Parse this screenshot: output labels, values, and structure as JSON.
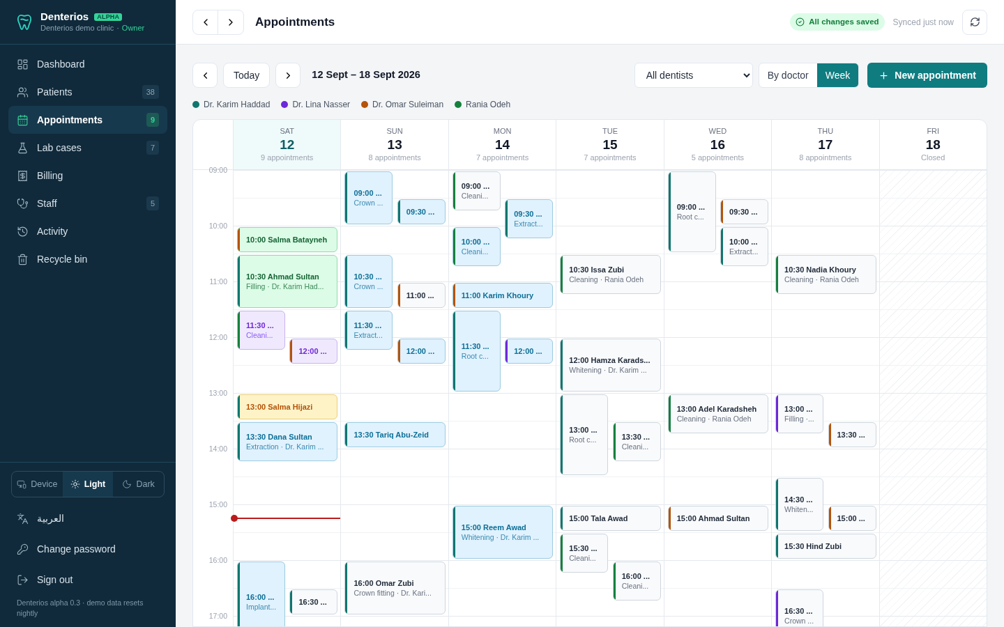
{
  "sidebar": {
    "brand": "Denterios",
    "badge": "ALPHA",
    "clinic": "Denterios demo clinic",
    "separator": "·",
    "role": "Owner",
    "nav": [
      {
        "label": "Dashboard",
        "selected": false
      },
      {
        "label": "Patients",
        "count": "38",
        "selected": false
      },
      {
        "label": "Appointments",
        "count": "9",
        "selected": true
      },
      {
        "label": "Lab cases",
        "count": "7",
        "selected": false
      },
      {
        "label": "Billing",
        "selected": false
      },
      {
        "label": "Staff",
        "count": "5",
        "selected": false
      },
      {
        "label": "Activity",
        "selected": false
      },
      {
        "label": "Recycle bin",
        "selected": false
      }
    ],
    "theme_options": [
      {
        "label": "Device",
        "selected": false
      },
      {
        "label": "Light",
        "selected": true
      },
      {
        "label": "Dark",
        "selected": false
      }
    ],
    "links": [
      "العربية",
      "Change password",
      "Sign out"
    ],
    "footer": "Denterios alpha 0.3 · demo data resets nightly"
  },
  "header": {
    "title": "Appointments",
    "save_status": "All changes saved",
    "sync_text": "Synced just now"
  },
  "toolbar": {
    "today": "Today",
    "range": "12 Sept – 18 Sept 2026",
    "dentist_select": "All dentists",
    "views": [
      {
        "label": "By doctor",
        "selected": false
      },
      {
        "label": "Week",
        "selected": true
      }
    ],
    "new_button": "New appointment"
  },
  "legend": [
    {
      "name": "Dr. Karim Haddad",
      "color": "#0f766e"
    },
    {
      "name": "Dr. Lina Nasser",
      "color": "#6d28d9"
    },
    {
      "name": "Dr. Omar Suleiman",
      "color": "#b45309"
    },
    {
      "name": "Rania Odeh",
      "color": "#15803d"
    }
  ],
  "calendar": {
    "times": [
      "09:00",
      "10:00",
      "11:00",
      "12:00",
      "13:00",
      "14:00",
      "15:00",
      "16:00",
      "17:00"
    ],
    "days": [
      {
        "weekday": "SAT",
        "date": "12",
        "summary": "9 appointments",
        "today": true,
        "closed": false,
        "events": [
          {
            "kind": "full30",
            "stripe": {
              "color": "#b45309"
            },
            "color": "#dcfce7",
            "time": "10:00",
            "name": "Salma Batayneh"
          },
          {
            "kind": "full60",
            "stripe": {
              "color": "#0f766e"
            },
            "color": "#dcfce7",
            "time": "10:30",
            "name": "Ahmad Sultan",
            "detail": "Filling · Dr. Karim Had..."
          },
          {
            "kind": "left45",
            "stripe": {
              "color": "#15803d"
            },
            "color": "#f0e9fd",
            "time": "11:30",
            "name": "...",
            "detail": "Cleani..."
          },
          {
            "kind": "right30",
            "stripe": {
              "color": "#b45309"
            },
            "color": "#f0e9fd",
            "time": "12:00",
            "name": "..."
          },
          {
            "kind": "full30",
            "stripe": {
              "color": "#0f766e"
            },
            "color": "#fef3c7",
            "time": "13:00",
            "name": "Salma Hijazi"
          },
          {
            "kind": "full45",
            "stripe": {
              "color": "#0f766e"
            },
            "color": "#e0f2fe",
            "time": "13:30",
            "name": "Dana Sultan",
            "detail": "Extraction · Dr. Karim ..."
          },
          {
            "kind": "left90",
            "stripe": {
              "color": "#0f766e"
            },
            "color": "#e0f2fe",
            "time": "16:00",
            "name": "...",
            "detail": "Implant..."
          },
          {
            "kind": "right30",
            "stripe": {
              "color": "#0f766e"
            },
            "color": "#f8fafc",
            "time": "16:30",
            "name": "..."
          }
        ]
      },
      {
        "weekday": "SUN",
        "date": "13",
        "summary": "8 appointments",
        "today": false,
        "closed": false,
        "events": [
          {
            "kind": "left60",
            "stripe": {
              "color": "#0f766e"
            },
            "color": "#e0f2fe",
            "time": "09:00",
            "name": "...",
            "detail": "Crown ..."
          },
          {
            "kind": "right30",
            "stripe": {
              "color": "#0f766e"
            },
            "color": "#e0f2fe",
            "time": "09:30",
            "name": "..."
          },
          {
            "kind": "left60",
            "stripe": {
              "color": "#0f766e"
            },
            "color": "#e0f2fe",
            "time": "10:30",
            "name": "...",
            "detail": "Crown ..."
          },
          {
            "kind": "right30",
            "stripe": {
              "color": "#b45309"
            },
            "color": "#f8fafc",
            "time": "11:00",
            "name": "..."
          },
          {
            "kind": "left45",
            "stripe": {
              "color": "#0f766e"
            },
            "color": "#e0f2fe",
            "time": "11:30",
            "name": "...",
            "detail": "Extract..."
          },
          {
            "kind": "right30",
            "stripe": {
              "color": "#b45309"
            },
            "color": "#e0f2fe",
            "time": "12:00",
            "name": "..."
          },
          {
            "kind": "full30",
            "stripe": {
              "color": "#0f766e"
            },
            "color": "#e0f2fe",
            "time": "13:30",
            "name": "Tariq Abu-Zeid"
          },
          {
            "kind": "full60",
            "stripe": {
              "color": "#0f766e"
            },
            "color": "#f8fafc",
            "time": "16:00",
            "name": "Omar Zubi",
            "detail": "Crown fitting · Dr. Kari..."
          }
        ]
      },
      {
        "weekday": "MON",
        "date": "14",
        "summary": "7 appointments",
        "today": false,
        "closed": false,
        "events": [
          {
            "kind": "left45",
            "stripe": {
              "color": "#15803d"
            },
            "color": "#f8fafc",
            "time": "09:00",
            "name": "...",
            "detail": "Cleani..."
          },
          {
            "kind": "right45",
            "stripe": {
              "color": "#0f766e"
            },
            "color": "#e0f2fe",
            "time": "09:30",
            "name": "...",
            "detail": "Extract..."
          },
          {
            "kind": "left45",
            "stripe": {
              "color": "#15803d"
            },
            "color": "#e0f2fe",
            "time": "10:00",
            "name": "...",
            "detail": "Cleani..."
          },
          {
            "kind": "full30",
            "stripe": {
              "color": "#b45309"
            },
            "color": "#e0f2fe",
            "time": "11:00",
            "name": "Karim Khoury"
          },
          {
            "kind": "left90",
            "stripe": {
              "color": "#0f766e"
            },
            "color": "#e0f2fe",
            "time": "11:30",
            "name": "...",
            "detail": "Root c..."
          },
          {
            "kind": "right30",
            "stripe": {
              "color": "#6d28d9"
            },
            "color": "#e0f2fe",
            "time": "12:00",
            "name": "..."
          },
          {
            "kind": "full60",
            "stripe": {
              "color": "#0f766e"
            },
            "color": "#e0f2fe",
            "time": "15:00",
            "name": "Reem Awad",
            "detail": "Whitening · Dr. Karim ..."
          }
        ]
      },
      {
        "weekday": "TUE",
        "date": "15",
        "summary": "7 appointments",
        "today": false,
        "closed": false,
        "events": [
          {
            "kind": "full45",
            "stripe": {
              "color": "#15803d"
            },
            "color": "#f8fafc",
            "time": "10:30",
            "name": "Issa Zubi",
            "detail": "Cleaning · Rania Odeh"
          },
          {
            "kind": "full60",
            "stripe": {
              "color": "#0f766e"
            },
            "color": "#f8fafc",
            "time": "12:00",
            "name": "Hamza Karads...",
            "detail": "Whitening · Dr. Karim ..."
          },
          {
            "kind": "left90",
            "stripe": {
              "color": "#0f766e"
            },
            "color": "#f8fafc",
            "time": "13:00",
            "name": "...",
            "detail": "Root c..."
          },
          {
            "kind": "right45",
            "stripe": {
              "color": "#15803d"
            },
            "color": "#f8fafc",
            "time": "13:30",
            "name": "...",
            "detail": "Cleani..."
          },
          {
            "kind": "full30",
            "stripe": {
              "color": "#0f766e"
            },
            "color": "#f8fafc",
            "time": "15:00",
            "name": "Tala Awad"
          },
          {
            "kind": "left45",
            "stripe": {
              "color": "#15803d"
            },
            "color": "#f8fafc",
            "time": "15:30",
            "name": "...",
            "detail": "Cleani..."
          },
          {
            "kind": "right45",
            "stripe": {
              "color": "#15803d"
            },
            "color": "#f8fafc",
            "time": "16:00",
            "name": "...",
            "detail": "Cleani..."
          }
        ]
      },
      {
        "weekday": "WED",
        "date": "16",
        "summary": "5 appointments",
        "today": false,
        "closed": false,
        "events": [
          {
            "kind": "left90",
            "stripe": {
              "color": "#0f766e"
            },
            "color": "#f8fafc",
            "time": "09:00",
            "name": "...",
            "detail": "Root c..."
          },
          {
            "kind": "right30",
            "stripe": {
              "color": "#b45309"
            },
            "color": "#f8fafc",
            "time": "09:30",
            "name": "..."
          },
          {
            "kind": "right45",
            "stripe": {
              "color": "#0f766e"
            },
            "color": "#f8fafc",
            "time": "10:00",
            "name": "...",
            "detail": "Extract..."
          },
          {
            "kind": "full45",
            "stripe": {
              "color": "#15803d"
            },
            "color": "#f8fafc",
            "time": "13:00",
            "name": "Adel Karadsheh",
            "detail": "Cleaning · Rania Odeh"
          },
          {
            "kind": "full30",
            "stripe": {
              "color": "#b45309"
            },
            "color": "#f8fafc",
            "time": "15:00",
            "name": "Ahmad Sultan"
          }
        ]
      },
      {
        "weekday": "THU",
        "date": "17",
        "summary": "8 appointments",
        "today": false,
        "closed": false,
        "events": [
          {
            "kind": "full45",
            "stripe": {
              "color": "#15803d"
            },
            "color": "#f8fafc",
            "time": "10:30",
            "name": "Nadia Khoury",
            "detail": "Cleaning · Rania Odeh"
          },
          {
            "kind": "left45",
            "stripe": {
              "color": "#6d28d9"
            },
            "color": "#f8fafc",
            "time": "13:00",
            "name": "...",
            "detail": "Filling ·..."
          },
          {
            "kind": "right30",
            "stripe": {
              "color": "#b45309"
            },
            "color": "#f8fafc",
            "time": "13:30",
            "name": "..."
          },
          {
            "kind": "left60",
            "stripe": {
              "color": "#0f766e"
            },
            "color": "#f8fafc",
            "time": "14:30",
            "name": "...",
            "detail": "Whiten..."
          },
          {
            "kind": "right30",
            "stripe": {
              "color": "#b45309"
            },
            "color": "#f8fafc",
            "time": "15:00",
            "name": "..."
          },
          {
            "kind": "full30",
            "stripe": {
              "color": "#0f766e"
            },
            "color": "#f8fafc",
            "time": "15:30",
            "name": "Hind Zubi"
          },
          {
            "kind": "left60",
            "stripe": {
              "color": "#6d28d9"
            },
            "color": "#f8fafc",
            "time": "16:30",
            "name": "...",
            "detail": "Crown ..."
          }
        ]
      },
      {
        "weekday": "FRI",
        "date": "18",
        "summary": "Closed",
        "today": false,
        "closed": true
      }
    ]
  }
}
